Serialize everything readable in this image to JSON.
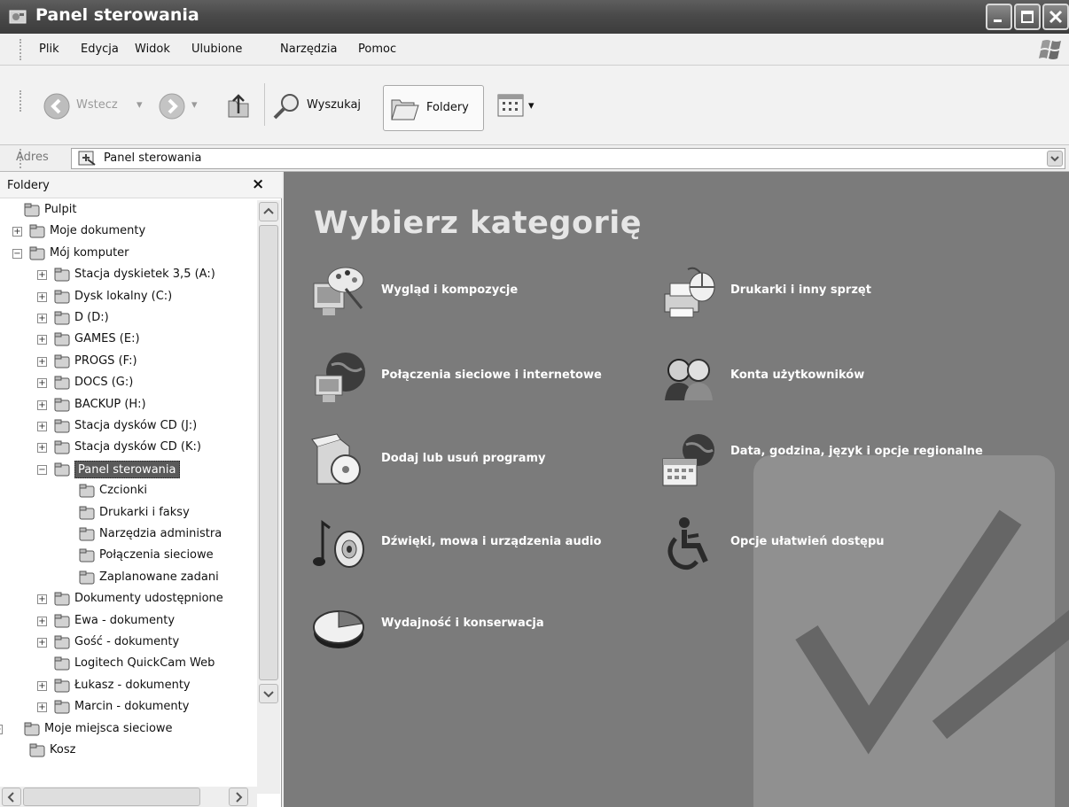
{
  "window": {
    "title": "Panel sterowania"
  },
  "menu": [
    "Plik",
    "Edycja",
    "Widok",
    "Ulubione",
    "Narzędzia",
    "Pomoc"
  ],
  "toolbar": {
    "back_label": "Wstecz",
    "search_label": "Wyszukaj",
    "folders_label": "Foldery"
  },
  "address": {
    "label": "Adres",
    "value": "Panel sterowania"
  },
  "folder_pane": {
    "title": "Foldery",
    "close_glyph": "×",
    "tree": [
      {
        "label": "Pulpit",
        "icon": "desktop-icon"
      },
      {
        "label": "Moje dokumenty",
        "icon": "folder-icon",
        "expander": "+"
      },
      {
        "label": "Mój komputer",
        "icon": "computer-icon",
        "expander": "−"
      },
      {
        "label": "Stacja dyskietek 3,5 (A:)",
        "icon": "floppy-icon",
        "expander": "+"
      },
      {
        "label": "Dysk lokalny (C:)",
        "icon": "drive-icon",
        "expander": "+"
      },
      {
        "label": "D (D:)",
        "icon": "drive-icon",
        "expander": "+"
      },
      {
        "label": "GAMES (E:)",
        "icon": "drive-icon",
        "expander": "+"
      },
      {
        "label": "PROGS (F:)",
        "icon": "shared-drive-icon",
        "expander": "+"
      },
      {
        "label": "DOCS (G:)",
        "icon": "shared-drive-icon",
        "expander": "+"
      },
      {
        "label": "BACKUP (H:)",
        "icon": "shared-drive-icon",
        "expander": "+"
      },
      {
        "label": "Stacja dysków CD (J:)",
        "icon": "cd-drive-icon",
        "expander": "+"
      },
      {
        "label": "Stacja dysków CD (K:)",
        "icon": "cd-drive-icon",
        "expander": "+"
      },
      {
        "label": "Panel sterowania",
        "icon": "control-panel-icon",
        "expander": "−",
        "selected": true
      },
      {
        "label": "Czcionki",
        "icon": "fonts-icon"
      },
      {
        "label": "Drukarki i faksy",
        "icon": "printer-icon"
      },
      {
        "label": "Narzędzia administra",
        "icon": "admin-tools-icon"
      },
      {
        "label": "Połączenia sieciowe",
        "icon": "network-icon"
      },
      {
        "label": "Zaplanowane zadani",
        "icon": "tasks-icon"
      },
      {
        "label": "Dokumenty udostępnione",
        "icon": "folder-icon",
        "expander": "+"
      },
      {
        "label": "Ewa - dokumenty",
        "icon": "folder-icon",
        "expander": "+"
      },
      {
        "label": "Gość - dokumenty",
        "icon": "folder-icon",
        "expander": "+"
      },
      {
        "label": "Logitech QuickCam Web",
        "icon": "webcam-icon"
      },
      {
        "label": "Łukasz - dokumenty",
        "icon": "folder-icon",
        "expander": "+"
      },
      {
        "label": "Marcin - dokumenty",
        "icon": "folder-icon",
        "expander": "+"
      },
      {
        "label": "Moje miejsca sieciowe",
        "icon": "network-places-icon",
        "expander": "+"
      },
      {
        "label": "Kosz",
        "icon": "recycle-bin-icon"
      }
    ]
  },
  "main": {
    "heading": "Wybierz kategorię",
    "categories": [
      {
        "label": "Wygląd i kompozycje",
        "icon": "appearance-icon"
      },
      {
        "label": "Drukarki i inny sprzęt",
        "icon": "printers-hardware-icon"
      },
      {
        "label": "Połączenia sieciowe i internetowe",
        "icon": "network-internet-icon"
      },
      {
        "label": "Konta użytkowników",
        "icon": "user-accounts-icon"
      },
      {
        "label": "Dodaj lub usuń programy",
        "icon": "add-remove-programs-icon"
      },
      {
        "label": "Data, godzina, język i opcje regionalne",
        "icon": "date-time-language-icon"
      },
      {
        "label": "Dźwięki, mowa i urządzenia audio",
        "icon": "sounds-audio-icon"
      },
      {
        "label": "Opcje ułatwień dostępu",
        "icon": "accessibility-icon"
      },
      {
        "label": "Wydajność i konserwacja",
        "icon": "performance-maintenance-icon"
      }
    ]
  }
}
